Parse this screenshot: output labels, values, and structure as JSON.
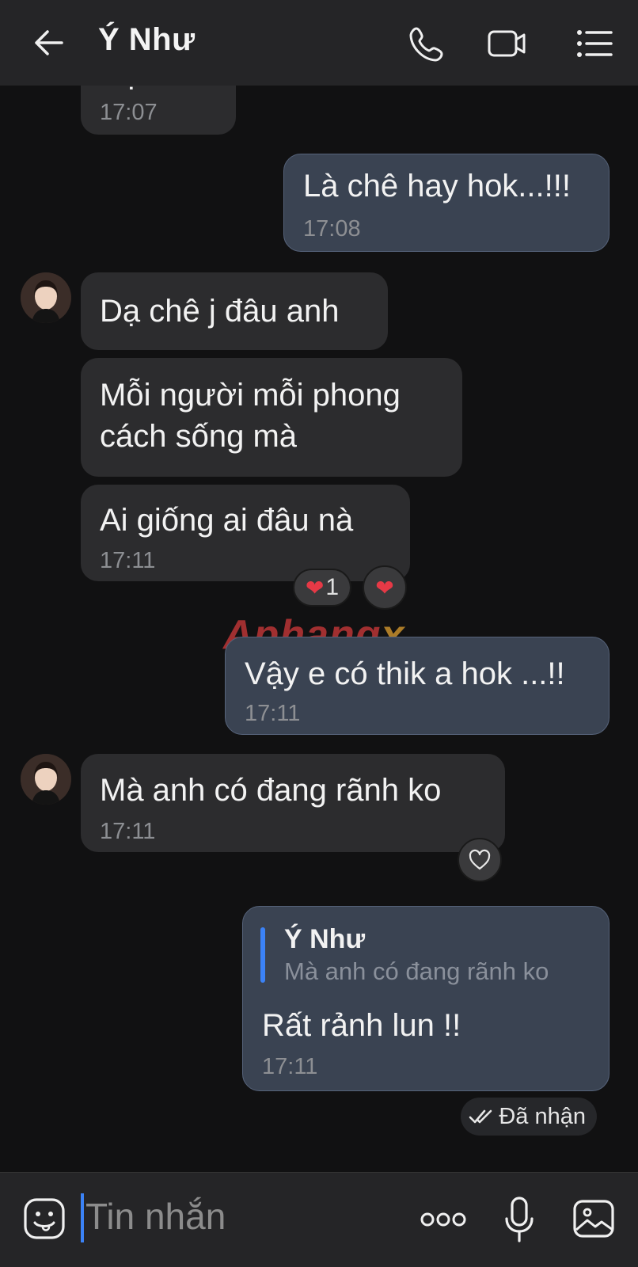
{
  "header": {
    "title": "Ý Như"
  },
  "messages": [
    {
      "text": "Dạ anh",
      "time": "17:07"
    },
    {
      "text": "Là chê hay hok...!!!",
      "time": "17:08"
    },
    {
      "text": "Dạ chê j đâu anh"
    },
    {
      "text": "Mỗi người mỗi phong\ncách sống mà"
    },
    {
      "text": "Ai giống ai đâu nà",
      "time": "17:11",
      "reaction_count": "1"
    },
    {
      "text": "Vậy e có thik a hok ...!!",
      "time": "17:11"
    },
    {
      "text": "Mà anh có đang rãnh ko",
      "time": "17:11"
    },
    {
      "reply_name": "Ý Như",
      "reply_text": "Mà anh có đang rãnh ko",
      "text": "Rất rảnh lun !!",
      "time": "17:11"
    }
  ],
  "watermark": {
    "part1": "Aphang",
    "part2": "x"
  },
  "status": {
    "label": "Đã nhận"
  },
  "composer": {
    "placeholder": "Tin nhắn"
  },
  "colors": {
    "accent": "#3b82f6",
    "outgoing_bubble": "#3a4352",
    "incoming_bubble": "#2c2c2e",
    "heart": "#e63946"
  }
}
